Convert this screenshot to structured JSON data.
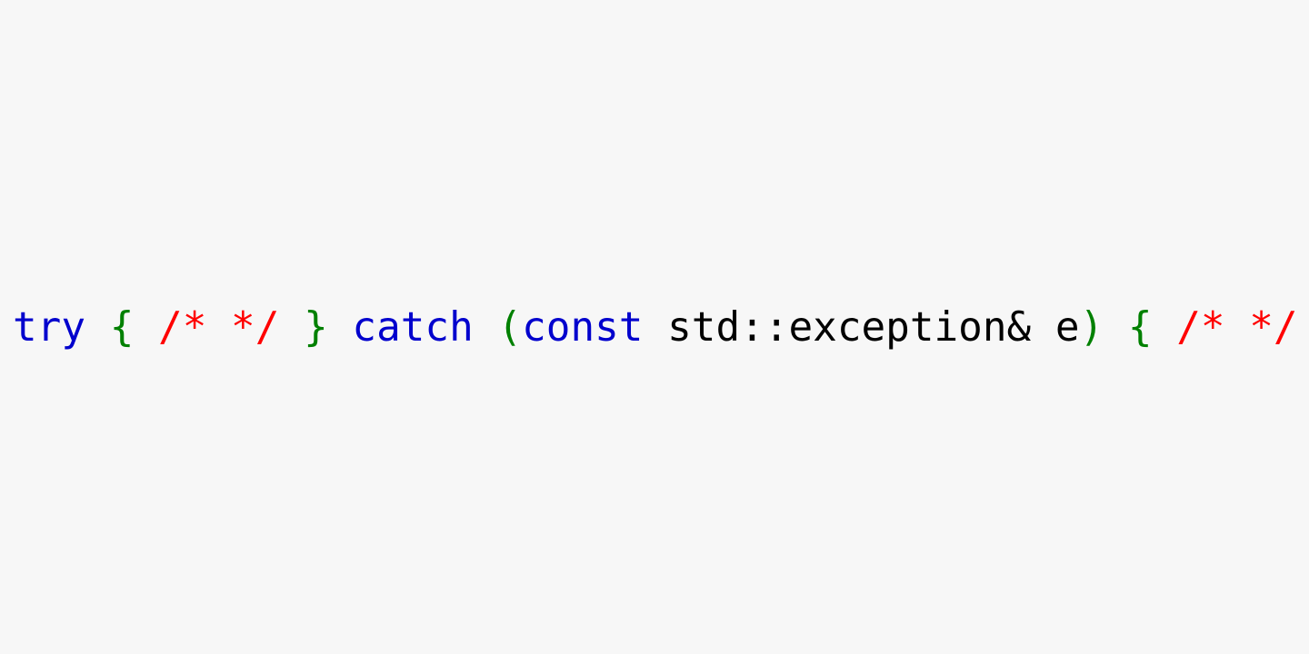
{
  "code": {
    "tokens": [
      {
        "text": "try",
        "class": "kw-blue"
      },
      {
        "text": " ",
        "class": "plain"
      },
      {
        "text": "{",
        "class": "brace-green"
      },
      {
        "text": " ",
        "class": "plain"
      },
      {
        "text": "/* */",
        "class": "comment-red"
      },
      {
        "text": " ",
        "class": "plain"
      },
      {
        "text": "}",
        "class": "brace-green"
      },
      {
        "text": " ",
        "class": "plain"
      },
      {
        "text": "catch",
        "class": "kw-blue"
      },
      {
        "text": " ",
        "class": "plain"
      },
      {
        "text": "(",
        "class": "paren-green"
      },
      {
        "text": "const",
        "class": "kw-blue"
      },
      {
        "text": " std::exception& e",
        "class": "plain"
      },
      {
        "text": ")",
        "class": "paren-green"
      },
      {
        "text": " ",
        "class": "plain"
      },
      {
        "text": "{",
        "class": "brace-green"
      },
      {
        "text": " ",
        "class": "plain"
      },
      {
        "text": "/* */",
        "class": "comment-red"
      },
      {
        "text": " ",
        "class": "plain"
      },
      {
        "text": "}",
        "class": "brace-green"
      }
    ]
  }
}
